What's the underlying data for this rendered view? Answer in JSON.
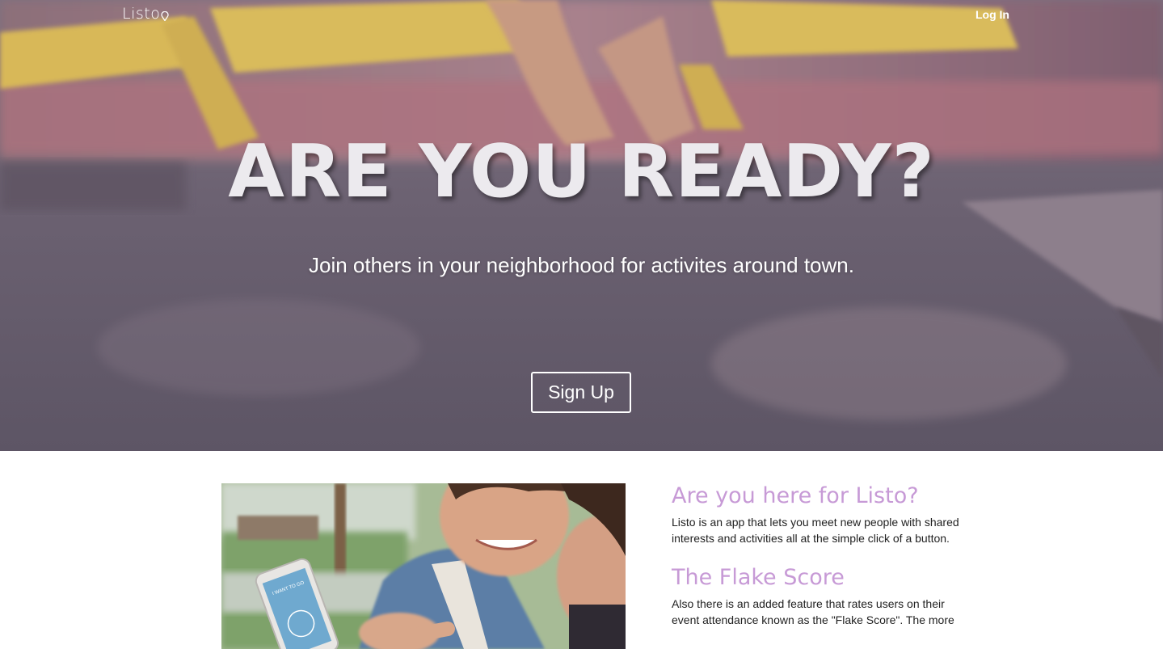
{
  "nav": {
    "logo": "Listo",
    "login_label": "Log In"
  },
  "hero": {
    "title": "ARE YOU READY?",
    "subtitle": "Join others in your neighborhood for activites around town.",
    "signup_label": "Sign Up"
  },
  "photo": {
    "phone_screen_text": "I WANT TO GO"
  },
  "sections": [
    {
      "heading": "Are you here for Listo?",
      "body": "Listo is an app that lets you meet new people with shared interests and activities all at the simple click of a button."
    },
    {
      "heading": "The Flake Score",
      "body": "Also there is an added feature that rates users on their event attendance known as the \"Flake Score\". The more"
    }
  ],
  "colors": {
    "accent": "#c79ad6",
    "hero_overlay": "#6d6472",
    "body_text": "#222222"
  },
  "icons": {
    "logo_pin": "map-pin-icon"
  }
}
